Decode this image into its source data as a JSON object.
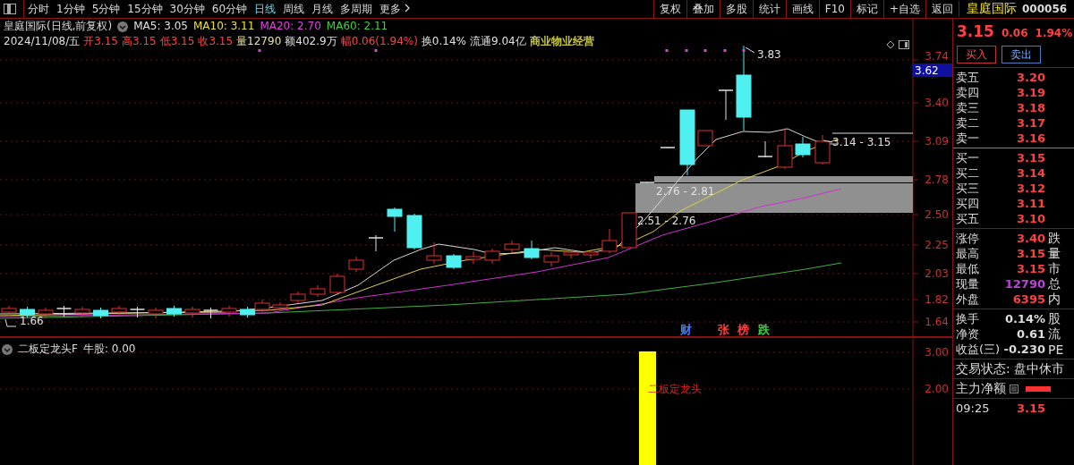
{
  "toolbar": {
    "periods": [
      {
        "label": "分时",
        "selected": false
      },
      {
        "label": "1分钟",
        "selected": false
      },
      {
        "label": "5分钟",
        "selected": false
      },
      {
        "label": "15分钟",
        "selected": false
      },
      {
        "label": "30分钟",
        "selected": false
      },
      {
        "label": "60分钟",
        "selected": false
      },
      {
        "label": "日线",
        "selected": true
      },
      {
        "label": "周线",
        "selected": false
      },
      {
        "label": "月线",
        "selected": false
      },
      {
        "label": "多周期",
        "selected": false
      }
    ],
    "more": "更多",
    "actions": [
      "复权",
      "叠加",
      "多股",
      "统计",
      "画线",
      "F10",
      "标记",
      "+自选",
      "返回"
    ]
  },
  "header": {
    "title": "皇庭国际(日线,前复权)",
    "ma": [
      {
        "label": "MA5: 3.05",
        "color": "#e0e0e0"
      },
      {
        "label": "MA10: 3.11",
        "color": "#e8e040"
      },
      {
        "label": "MA20: 2.70",
        "color": "#e040e0"
      },
      {
        "label": "MA60: 2.11",
        "color": "#40d040"
      }
    ]
  },
  "quote_line": [
    {
      "text": "2024/11/08/五",
      "color": "#e0e0e0"
    },
    {
      "text": "开3.15",
      "color": "#ff4040"
    },
    {
      "text": "高3.15",
      "color": "#ff4040"
    },
    {
      "text": "低3.15",
      "color": "#ff4040"
    },
    {
      "text": "收3.15",
      "color": "#ff4040"
    },
    {
      "text": "量12790",
      "color": "#e8e0a0"
    },
    {
      "text": "额402.9万",
      "color": "#e0e0e0"
    },
    {
      "text": "幅0.06(1.94%)",
      "color": "#ff4040"
    },
    {
      "text": "换0.14%",
      "color": "#e0e0e0"
    },
    {
      "text": "流通9.04亿",
      "color": "#e0e0e0"
    },
    {
      "text": "商业物业经营",
      "color": "#c8c840"
    }
  ],
  "chart": {
    "y_ticks": [
      "3.74",
      "3.40",
      "3.09",
      "2.78",
      "2.50",
      "2.25",
      "2.03",
      "1.82",
      "1.64"
    ],
    "price_tag": "3.62",
    "annotations": [
      {
        "kind": "high",
        "text": "3.83"
      },
      {
        "kind": "low",
        "text": "1.66"
      },
      {
        "kind": "band_upper",
        "text": "2.76 - 2.81"
      },
      {
        "kind": "band_lower",
        "text": "2.51 - 2.76"
      },
      {
        "kind": "last",
        "text": "3.14 - 3.15"
      }
    ],
    "markers": [
      {
        "text": "财",
        "color": "#4080ff"
      },
      {
        "text": "张",
        "color": "#ff4040"
      },
      {
        "text": "榜",
        "color": "#ff4040"
      },
      {
        "text": "跌",
        "color": "#40d040"
      }
    ]
  },
  "indicator": {
    "title": "二板定龙头F",
    "value": "牛股: 0.00",
    "y_ticks": [
      "3.00",
      "2.00"
    ],
    "bar_label": "二板定龙头"
  },
  "quote_panel": {
    "name": "皇庭国际",
    "code": "000056",
    "price": "3.15",
    "change": "0.06",
    "change_pct": "1.94%",
    "buttons": [
      {
        "label": "买入",
        "kind": "buy"
      },
      {
        "label": "卖出",
        "kind": "sell"
      }
    ],
    "asks": [
      {
        "label": "卖五",
        "price": "3.20"
      },
      {
        "label": "卖四",
        "price": "3.19"
      },
      {
        "label": "卖三",
        "price": "3.18"
      },
      {
        "label": "卖二",
        "price": "3.17"
      },
      {
        "label": "卖一",
        "price": "3.16"
      }
    ],
    "bids": [
      {
        "label": "买一",
        "price": "3.15"
      },
      {
        "label": "买二",
        "price": "3.14"
      },
      {
        "label": "买三",
        "price": "3.12"
      },
      {
        "label": "买四",
        "price": "3.11"
      },
      {
        "label": "买五",
        "price": "3.10"
      }
    ],
    "stats": [
      {
        "label": "涨停",
        "value": "3.40",
        "color": "#ff4040",
        "extra": "跌"
      },
      {
        "label": "最高",
        "value": "3.15",
        "color": "#ff4040",
        "extra": "量"
      },
      {
        "label": "最低",
        "value": "3.15",
        "color": "#ff4040",
        "extra": "市"
      },
      {
        "label": "现量",
        "value": "12790",
        "color": "#c040e0",
        "extra": "总"
      },
      {
        "label": "外盘",
        "value": "6395",
        "color": "#ff4040",
        "extra": "内"
      }
    ],
    "ratios": [
      {
        "label": "换手",
        "value": "0.14%",
        "extra": "股"
      },
      {
        "label": "净资",
        "value": "0.61",
        "extra": "流"
      },
      {
        "label": "收益(三)",
        "value": "-0.230",
        "extra": "PE"
      }
    ],
    "trade_status": "交易状态: 盘中休市",
    "main_flow": "主力净额",
    "tick": {
      "time": "09:25",
      "price": "3.15"
    }
  }
}
